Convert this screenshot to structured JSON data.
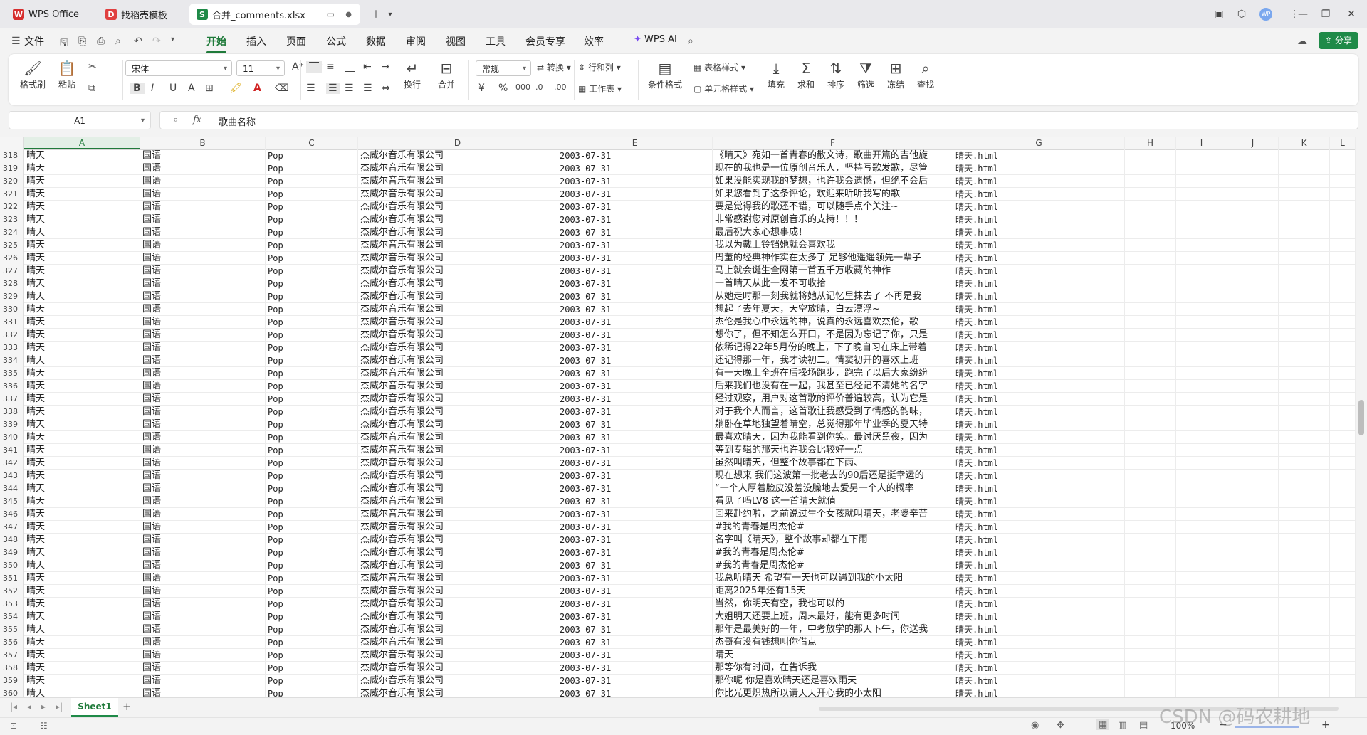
{
  "tabs": [
    {
      "label": "WPS Office",
      "icon": "wps-logo-icon"
    },
    {
      "label": "找稻壳模板",
      "icon": "docer-icon"
    },
    {
      "label": "合并_comments.xlsx",
      "icon": "spreadsheet-icon"
    }
  ],
  "menu": {
    "file": "文件",
    "items": [
      "开始",
      "插入",
      "页面",
      "公式",
      "数据",
      "审阅",
      "视图",
      "工具",
      "会员专享",
      "效率"
    ],
    "active": "开始",
    "wps_ai": "WPS AI",
    "share": "分享"
  },
  "ribbon": {
    "format_painter": "格式刷",
    "paste": "粘贴",
    "font_name": "宋体",
    "font_size": "11",
    "wrap": "换行",
    "merge": "合并",
    "number_format": "常规",
    "convert": "转换",
    "row_col": "行和列",
    "worksheet": "工作表",
    "cond_format": "条件格式",
    "table_style": "表格样式",
    "cell_style": "单元格样式",
    "fill": "填充",
    "sum": "求和",
    "sort": "排序",
    "filter": "筛选",
    "freeze": "冻结",
    "find": "查找"
  },
  "formula_bar": {
    "cell_ref": "A1",
    "fx": "fx",
    "content": "歌曲名称"
  },
  "columns": [
    "A",
    "B",
    "C",
    "D",
    "E",
    "F",
    "G",
    "H",
    "I",
    "J",
    "K",
    "L"
  ],
  "selected_column": "A",
  "constant_cells": {
    "song": "晴天",
    "language": "国语",
    "genre": "Pop",
    "company": "杰威尔音乐有限公司",
    "date": "2003-07-31",
    "file": "晴天.html"
  },
  "rows": [
    {
      "n": "318",
      "comment": "《晴天》宛如一首青春的散文诗，歌曲开篇的吉他旋"
    },
    {
      "n": "319",
      "comment": "现在的我也是一位原创音乐人，坚持写歌发歌，尽管"
    },
    {
      "n": "320",
      "comment": "如果没能实现我的梦想，也许我会遗憾，但绝不会后"
    },
    {
      "n": "321",
      "comment": "如果您看到了这条评论，欢迎来听听我写的歌"
    },
    {
      "n": "322",
      "comment": "要是觉得我的歌还不错，可以随手点个关注~"
    },
    {
      "n": "323",
      "comment": "非常感谢您对原创音乐的支持！！！"
    },
    {
      "n": "324",
      "comment": "最后祝大家心想事成！"
    },
    {
      "n": "325",
      "comment": "我以为戴上铃铛她就会喜欢我"
    },
    {
      "n": "326",
      "comment": "周董的经典神作实在太多了 足够他遥遥领先一辈子"
    },
    {
      "n": "327",
      "comment": "马上就会诞生全网第一首五千万收藏的神作"
    },
    {
      "n": "328",
      "comment": "一首晴天从此一发不可收拾"
    },
    {
      "n": "329",
      "comment": "从她走时那一刻我就将她从记忆里抹去了 不再是我"
    },
    {
      "n": "330",
      "comment": "想起了去年夏天，天空放晴，白云漂浮~"
    },
    {
      "n": "331",
      "comment": "杰伦是我心中永远的神，说真的永远喜欢杰伦，歌"
    },
    {
      "n": "332",
      "comment": "想你了，但不知怎么开口，不是因为忘记了你，只是"
    },
    {
      "n": "333",
      "comment": "依稀记得22年5月份的晚上，下了晚自习在床上带着"
    },
    {
      "n": "334",
      "comment": "还记得那一年，我才读初二。情窦初开的喜欢上班"
    },
    {
      "n": "335",
      "comment": "有一天晚上全班在后操场跑步，跑完了以后大家纷纷"
    },
    {
      "n": "336",
      "comment": "后来我们也没有在一起，我甚至已经记不清她的名字"
    },
    {
      "n": "337",
      "comment": "经过观察，用户对这首歌的评价普遍较高，认为它是"
    },
    {
      "n": "338",
      "comment": "对于我个人而言，这首歌让我感受到了情感的韵味，"
    },
    {
      "n": "339",
      "comment": "躺卧在草地独望着晴空，总觉得那年毕业季的夏天特"
    },
    {
      "n": "340",
      "comment": "最喜欢晴天，因为我能看到你笑。最讨厌黑夜，因为"
    },
    {
      "n": "341",
      "comment": "等到专辑的那天也许我会比较好一点"
    },
    {
      "n": "342",
      "comment": "虽然叫晴天，但整个故事都在下雨、"
    },
    {
      "n": "343",
      "comment": "现在想来 我们这波第一批老去的90后还是挺幸运的"
    },
    {
      "n": "344",
      "comment": "“一个人厚着脸皮没羞没臊地去爱另一个人的概率"
    },
    {
      "n": "345",
      "comment": "看见了吗LV8 这一首晴天就值"
    },
    {
      "n": "346",
      "comment": "回来赴约啦，之前说过生个女孩就叫晴天，老婆辛苦"
    },
    {
      "n": "347",
      "comment": "#我的青春是周杰伦#"
    },
    {
      "n": "348",
      "comment": "名字叫《晴天》，整个故事却都在下雨"
    },
    {
      "n": "349",
      "comment": "#我的青春是周杰伦#"
    },
    {
      "n": "350",
      "comment": "#我的青春是周杰伦#"
    },
    {
      "n": "351",
      "comment": "我总听晴天 希望有一天也可以遇到我的小太阳"
    },
    {
      "n": "352",
      "comment": "距离2025年还有15天"
    },
    {
      "n": "353",
      "comment": "当然，你明天有空，我也可以的"
    },
    {
      "n": "354",
      "comment": "大姐明天还要上班，周末最好，能有更多时间"
    },
    {
      "n": "355",
      "comment": "那年是最美好的一年，中考放学的那天下午，你送我"
    },
    {
      "n": "356",
      "comment": "杰哥有没有钱想叫你借点"
    },
    {
      "n": "357",
      "comment": "晴天"
    },
    {
      "n": "358",
      "comment": "那等你有时间，在告诉我"
    },
    {
      "n": "359",
      "comment": "那你呢 你是喜欢晴天还是喜欢雨天"
    },
    {
      "n": "360",
      "comment": "你比光更炽热所以请天天开心我的小太阳"
    }
  ],
  "sheet": {
    "name": "Sheet1",
    "add": "+"
  },
  "status": {
    "zoom": "100%",
    "watermark": "CSDN @码农耕地"
  }
}
